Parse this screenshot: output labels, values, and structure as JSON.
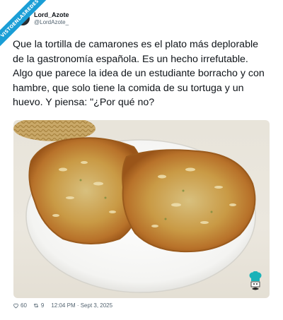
{
  "ribbon": {
    "text": "VISTOENLASREDES"
  },
  "author": {
    "display_name": "Lord_Azote",
    "handle": "@LordAzote_"
  },
  "tweet": {
    "lines": [
      "Que la tortilla de camarones es el plato más deplorable",
      "de la gastronomía española. Es un hecho irrefutable.",
      "Algo que parece la idea de un estudiante borracho y con",
      "hambre, que solo tiene la comida de su tortuga y un",
      "huevo. Y piensa: \"¿Por qué no?"
    ]
  },
  "footer": {
    "likes": "60",
    "retweets": "9",
    "timestamp": "12:04 PM · Sept 3, 2025"
  },
  "colors": {
    "ribbon": "#1a9ed6",
    "logo_teal": "#1ab2b8",
    "secondary_text": "#536471"
  },
  "icons": [
    "heart-icon",
    "retweet-icon",
    "chef-logo-icon"
  ]
}
